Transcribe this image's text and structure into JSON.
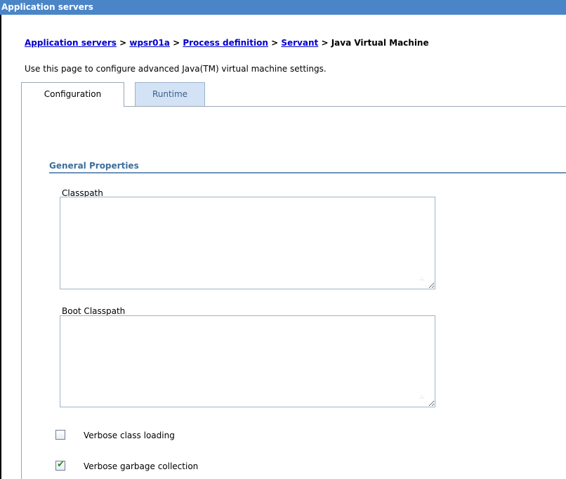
{
  "window": {
    "title": "Application servers"
  },
  "breadcrumb": {
    "items": [
      {
        "label": "Application servers",
        "link": true
      },
      {
        "label": "wpsr01a",
        "link": true
      },
      {
        "label": "Process definition",
        "link": true
      },
      {
        "label": "Servant",
        "link": true
      },
      {
        "label": "Java Virtual Machine",
        "link": false
      }
    ],
    "separator": ">"
  },
  "page": {
    "description": "Use this page to configure advanced Java(TM) virtual machine settings."
  },
  "tabs": [
    {
      "label": "Configuration",
      "active": true
    },
    {
      "label": "Runtime",
      "active": false
    }
  ],
  "general_properties": {
    "heading": "General Properties",
    "classpath": {
      "label": "Classpath",
      "value": ""
    },
    "boot_classpath": {
      "label": "Boot Classpath",
      "value": ""
    },
    "verbose_class_loading": {
      "label": "Verbose class loading",
      "checked": false
    },
    "verbose_gc": {
      "label": "Verbose garbage collection",
      "checked": true
    }
  },
  "colors": {
    "title_bar": "#4a85c8",
    "link": "#0000cc",
    "section_heading": "#3d6e9c",
    "check_mark": "#2a8a2a"
  },
  "icons": {
    "check": "check-mark-icon",
    "resize": "resize-grip-icon"
  }
}
